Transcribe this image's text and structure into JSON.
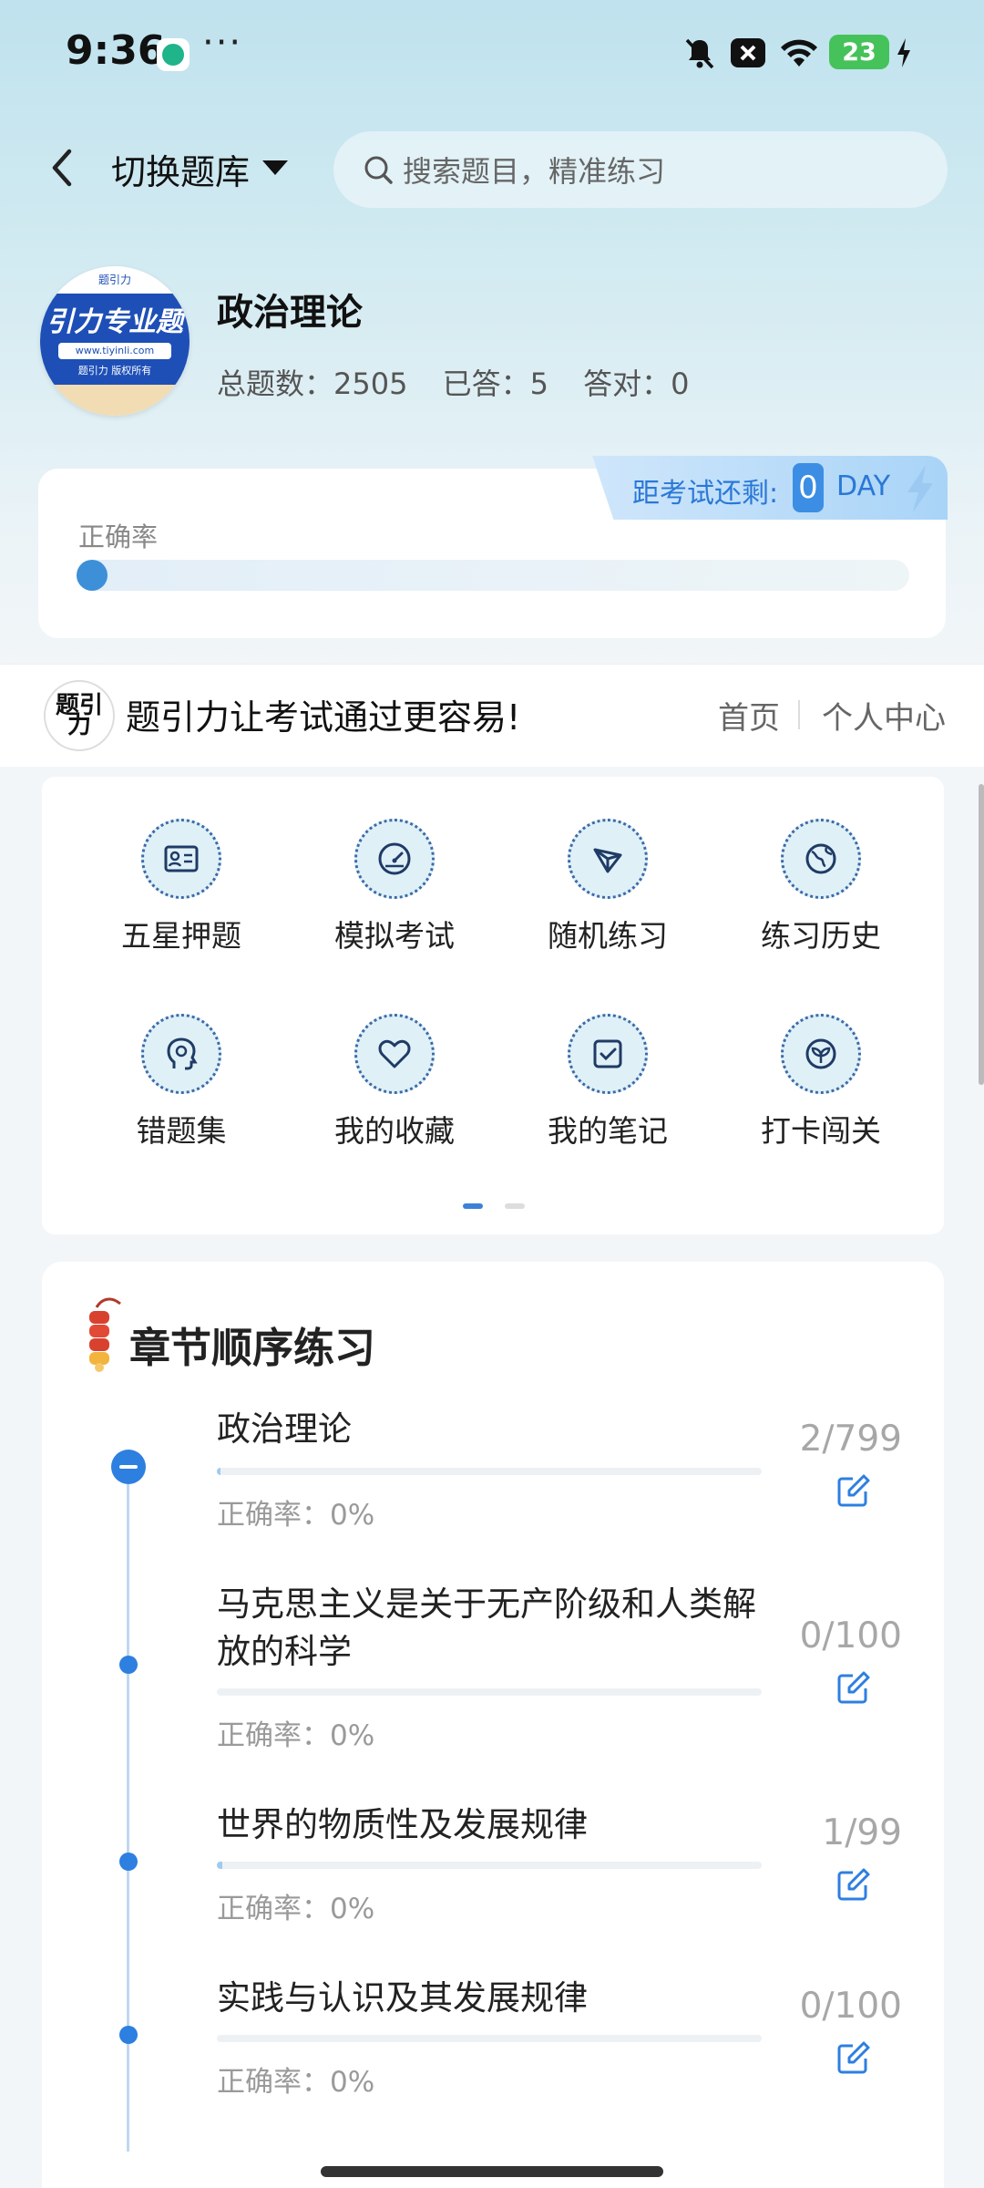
{
  "status_bar": {
    "time": "9:36",
    "battery": "23",
    "more": "···"
  },
  "header": {
    "switch_label": "切换题库",
    "search_placeholder": "搜索题目，精准练习"
  },
  "bank": {
    "logo_text": "引力专业题",
    "logo_url": "www.tiyinli.com",
    "logo_sub": "题引力 版权所有",
    "title": "政治理论",
    "total_label": "总题数：2505",
    "answered_label": "已答：5",
    "correct_label": "答对：0"
  },
  "exam": {
    "label": "距考试还剩:",
    "days": "0",
    "unit": "DAY"
  },
  "accuracy": {
    "label": "正确率",
    "value": 0
  },
  "slogan_bar": {
    "logo_text": "题引力",
    "slogan": "题引力让考试通过更容易!",
    "home": "首页",
    "personal": "个人中心"
  },
  "grid": {
    "items": [
      {
        "label": "五星押题",
        "icon": "id-card-icon"
      },
      {
        "label": "模拟考试",
        "icon": "gauge-icon"
      },
      {
        "label": "随机练习",
        "icon": "shuffle-icon"
      },
      {
        "label": "练习历史",
        "icon": "globe-icon"
      },
      {
        "label": "错题集",
        "icon": "head-icon"
      },
      {
        "label": "我的收藏",
        "icon": "heart-icon"
      },
      {
        "label": "我的笔记",
        "icon": "note-check-icon"
      },
      {
        "label": "打卡闯关",
        "icon": "sprout-icon"
      }
    ],
    "page_index": 0,
    "page_count": 2
  },
  "chapters": {
    "title": "章节顺序练习",
    "items": [
      {
        "title": "政治理论",
        "accuracy": "正确率：0%",
        "count": "2/799",
        "progress": 0.0025
      },
      {
        "title": "马克思主义是关于无产阶级和人类解放的科学",
        "accuracy": "正确率：0%",
        "count": "0/100",
        "progress": 0
      },
      {
        "title": "世界的物质性及发展规律",
        "accuracy": "正确率：0%",
        "count": "1/99",
        "progress": 0.0101
      },
      {
        "title": "实践与认识及其发展规律",
        "accuracy": "正确率：0%",
        "count": "0/100",
        "progress": 0
      }
    ]
  }
}
